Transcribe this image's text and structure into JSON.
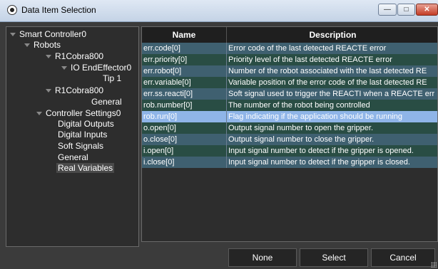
{
  "window": {
    "title": "Data Item Selection",
    "min": "—",
    "max": "□",
    "close": "✕"
  },
  "tree": [
    {
      "label": "Smart Controller0"
    },
    {
      "label": "Robots"
    },
    {
      "label": "R1Cobra800"
    },
    {
      "label": "IO EndEffector0"
    },
    {
      "label": "Tip 1"
    },
    {
      "label": "R1Cobra800"
    },
    {
      "label": "General"
    },
    {
      "label": "Controller Settings0"
    },
    {
      "label": "Digital Outputs"
    },
    {
      "label": "Digital Inputs"
    },
    {
      "label": "Soft Signals"
    },
    {
      "label": "General"
    },
    {
      "label": "Real Variables"
    }
  ],
  "grid": {
    "headers": [
      "Name",
      "Description"
    ],
    "rows": [
      {
        "name": "err.code[0]",
        "desc": "Error code of the last detected REACTE error"
      },
      {
        "name": "err.priority[0]",
        "desc": "Priority level of the last detected REACTE error"
      },
      {
        "name": "err.robot[0]",
        "desc": "Number of the robot associated with the last detected RE"
      },
      {
        "name": "err.variable[0]",
        "desc": "Variable position of the error code of the last detected RE"
      },
      {
        "name": "err.ss.reacti[0]",
        "desc": "Soft signal used to trigger the REACTI when a REACTE err"
      },
      {
        "name": "rob.number[0]",
        "desc": "The number of the robot being controlled"
      },
      {
        "name": "rob.run[0]",
        "desc": "Flag indicating if the application should be running"
      },
      {
        "name": "o.open[0]",
        "desc": "Output signal number to open the gripper."
      },
      {
        "name": "o.close[0]",
        "desc": "Output signal number to close the gripper."
      },
      {
        "name": "i.open[0]",
        "desc": "Input signal number to detect if the gripper is opened."
      },
      {
        "name": "i.close[0]",
        "desc": "Input signal number to detect if the gripper is closed."
      }
    ]
  },
  "buttons": {
    "none": "None",
    "select": "Select",
    "cancel": "Cancel"
  }
}
